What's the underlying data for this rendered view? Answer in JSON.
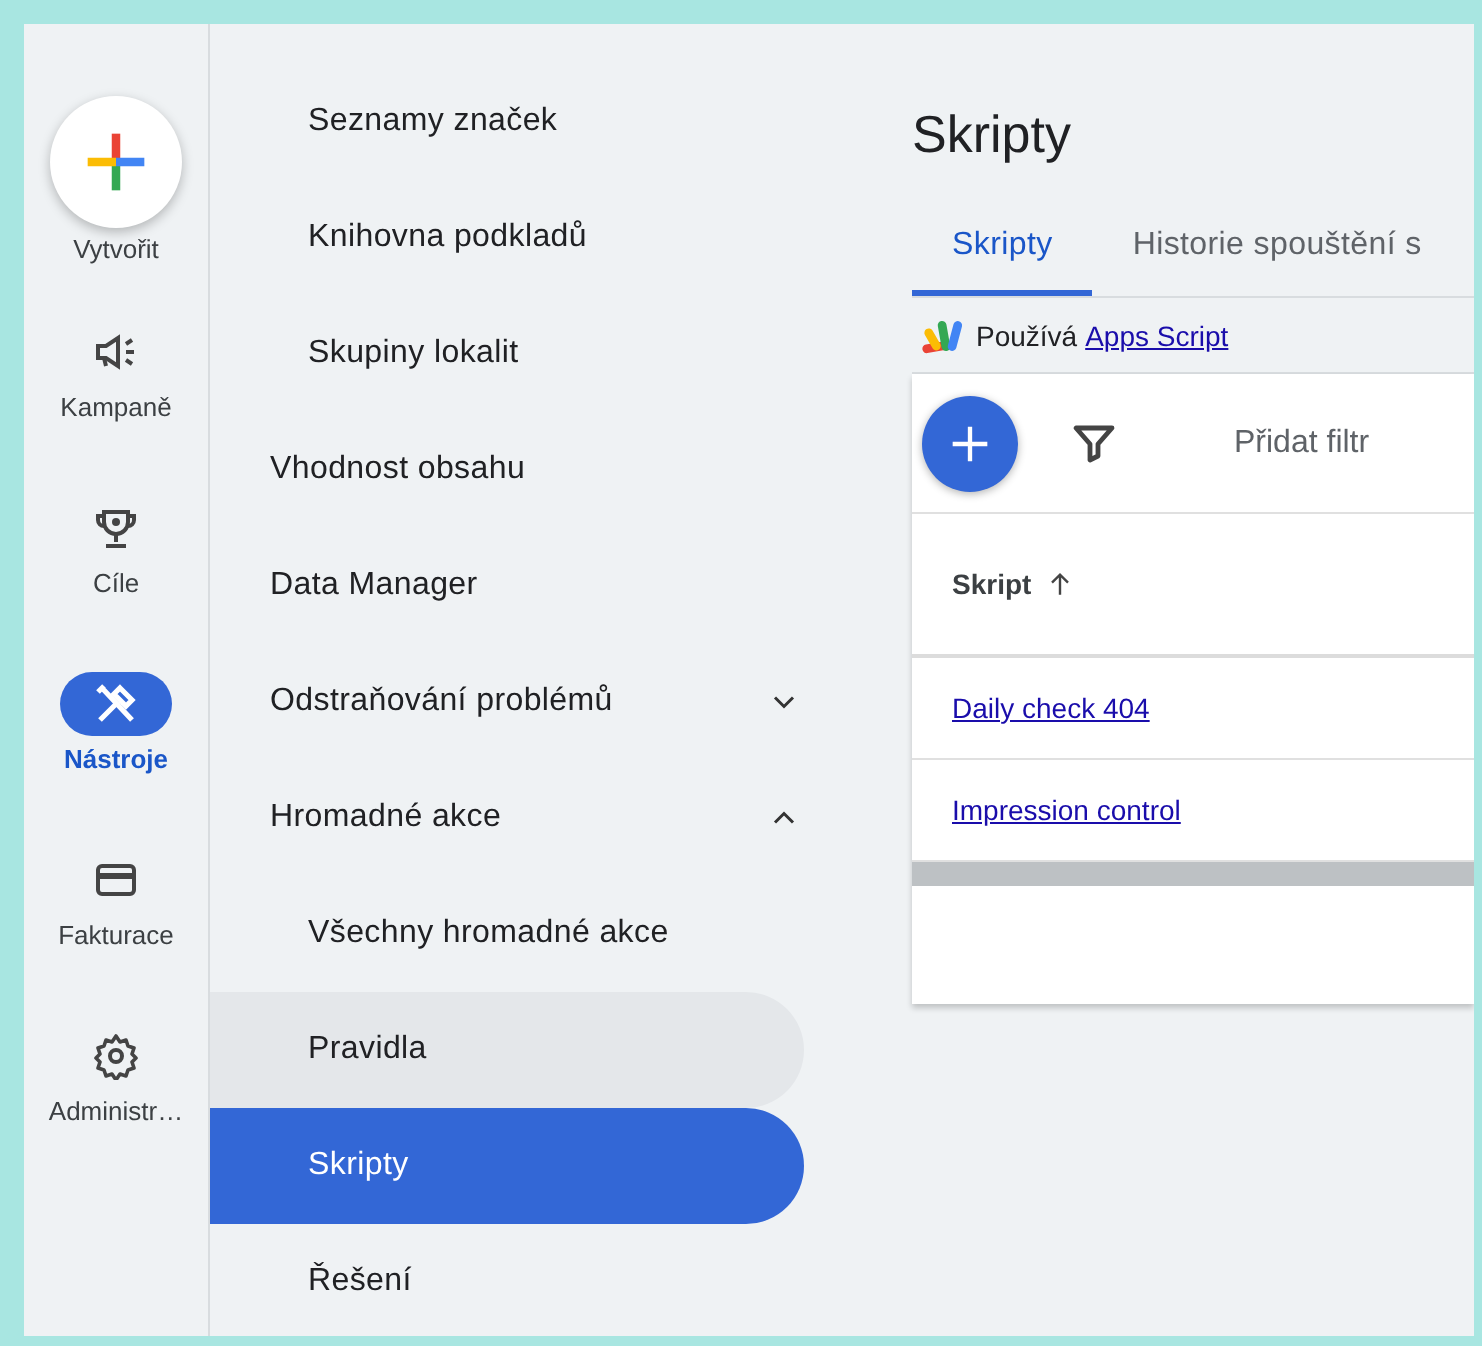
{
  "rail": {
    "create": {
      "label": "Vytvořit"
    },
    "items": [
      {
        "label": "Kampaně",
        "selected": false
      },
      {
        "label": "Cíle",
        "selected": false
      },
      {
        "label": "Nástroje",
        "selected": true
      },
      {
        "label": "Fakturace",
        "selected": false
      },
      {
        "label": "Administr…",
        "selected": false
      }
    ]
  },
  "nav": {
    "items": [
      {
        "children": [
          {
            "label": "Seznamy značek",
            "selected": false
          },
          {
            "label": "Knihovna podkladů",
            "selected": false
          },
          {
            "label": "Skupiny lokalit",
            "selected": false
          }
        ]
      },
      {
        "label": "Vhodnost obsahu",
        "selected": false
      },
      {
        "label": "Data Manager",
        "selected": false
      },
      {
        "label": "Odstraňování problémů",
        "selected": false,
        "expanded": false
      },
      {
        "label": "Hromadné akce",
        "selected": false,
        "expanded": true,
        "children": [
          {
            "label": "Všechny hromadné akce",
            "selected": false,
            "hovered": false
          },
          {
            "label": "Pravidla",
            "selected": false,
            "hovered": true
          },
          {
            "label": "Skripty",
            "selected": true,
            "hovered": false
          },
          {
            "label": "Řešení",
            "selected": false,
            "hovered": false
          }
        ]
      }
    ]
  },
  "page": {
    "title": "Skripty",
    "tabs": [
      {
        "label": "Skripty",
        "selected": true
      },
      {
        "label": "Historie spouštění s",
        "selected": false
      }
    ],
    "powered_by": {
      "text": "Používá",
      "link": "Apps Script"
    },
    "toolbar": {
      "filter_label": "Přidat filtr"
    },
    "table": {
      "columns": [
        {
          "label": "Skript",
          "sorted": true
        }
      ],
      "rows": [
        {
          "name": "Daily check 404"
        },
        {
          "name": "Impression control"
        }
      ]
    }
  }
}
